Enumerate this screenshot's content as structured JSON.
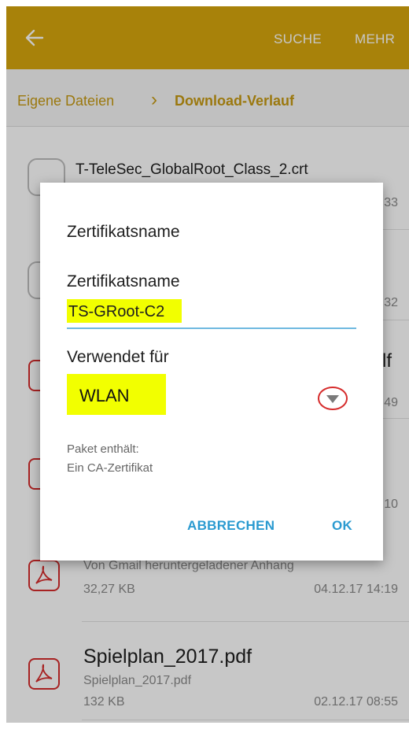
{
  "topbar": {
    "color": "#d8a70d",
    "back_icon": "arrow-left-icon",
    "search_label": "SUCHE",
    "more_label": "MEHR"
  },
  "breadcrumb": {
    "root": "Eigene Dateien",
    "separator": "›",
    "current": "Download-Verlauf"
  },
  "files": [
    {
      "title": "T-TeleSec_GlobalRoot_Class_2.crt",
      "date_tail": "33"
    },
    {
      "date_tail": "32"
    },
    {
      "title_tail": "lf",
      "date_tail": "49"
    },
    {
      "date_tail": "10"
    },
    {
      "sub": "Von Gmail heruntergeladener Anhang",
      "size": "32,27 KB",
      "date": "04.12.17 14:19"
    },
    {
      "title": "Spielplan_2017.pdf",
      "sub": "Spielplan_2017.pdf",
      "size": "132 KB",
      "date": "02.12.17 08:55"
    }
  ],
  "dialog": {
    "title": "Zertifikatsname",
    "name_label": "Zertifikatsname",
    "name_value": "TS-GRoot-C2",
    "used_for_label": "Verwendet für",
    "used_for_value": "WLAN",
    "package_label": "Paket enthält:",
    "package_value": "Ein CA-Zertifikat",
    "cancel_label": "ABBRECHEN",
    "ok_label": "OK",
    "accent_color": "#2a9ad0",
    "highlight_color": "#f2ff00"
  }
}
